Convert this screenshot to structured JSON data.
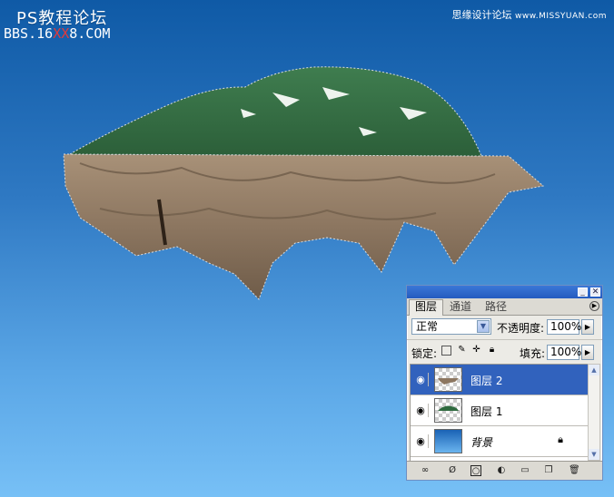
{
  "watermark": {
    "title": "PS教程论坛",
    "site_prefix": "BBS.16",
    "site_red": "XX",
    "site_suffix": "8.COM",
    "right_label": "思缘设计论坛",
    "right_site": "www.MISSYUAN.com"
  },
  "panel": {
    "tabs": [
      "图层",
      "通道",
      "路径"
    ],
    "active_tab": "图层",
    "blend_mode": "正常",
    "opacity_label": "不透明度:",
    "opacity_value": "100%",
    "lock_label": "锁定:",
    "fill_label": "填充:",
    "fill_value": "100%",
    "layers": [
      {
        "name": "图层 2",
        "selected": true,
        "visible": true
      },
      {
        "name": "图层 1",
        "selected": false,
        "visible": true
      },
      {
        "name": "背景",
        "selected": false,
        "visible": true,
        "locked": true
      }
    ],
    "icons": {
      "eye": "eye-icon",
      "lock_transparency": "lock-transparency-icon",
      "lock_paint": "brush-icon",
      "lock_move": "move-icon",
      "lock_all": "lock-icon",
      "bottom": [
        "link-icon",
        "fx-icon",
        "mask-icon",
        "adjustment-icon",
        "folder-icon",
        "new-layer-icon",
        "trash-icon"
      ]
    }
  },
  "colors": {
    "selection": "#3162bd",
    "titlebar": "#2f6ad0",
    "bg_top": "#0f5aa6",
    "bg_bottom": "#77c0f6"
  }
}
